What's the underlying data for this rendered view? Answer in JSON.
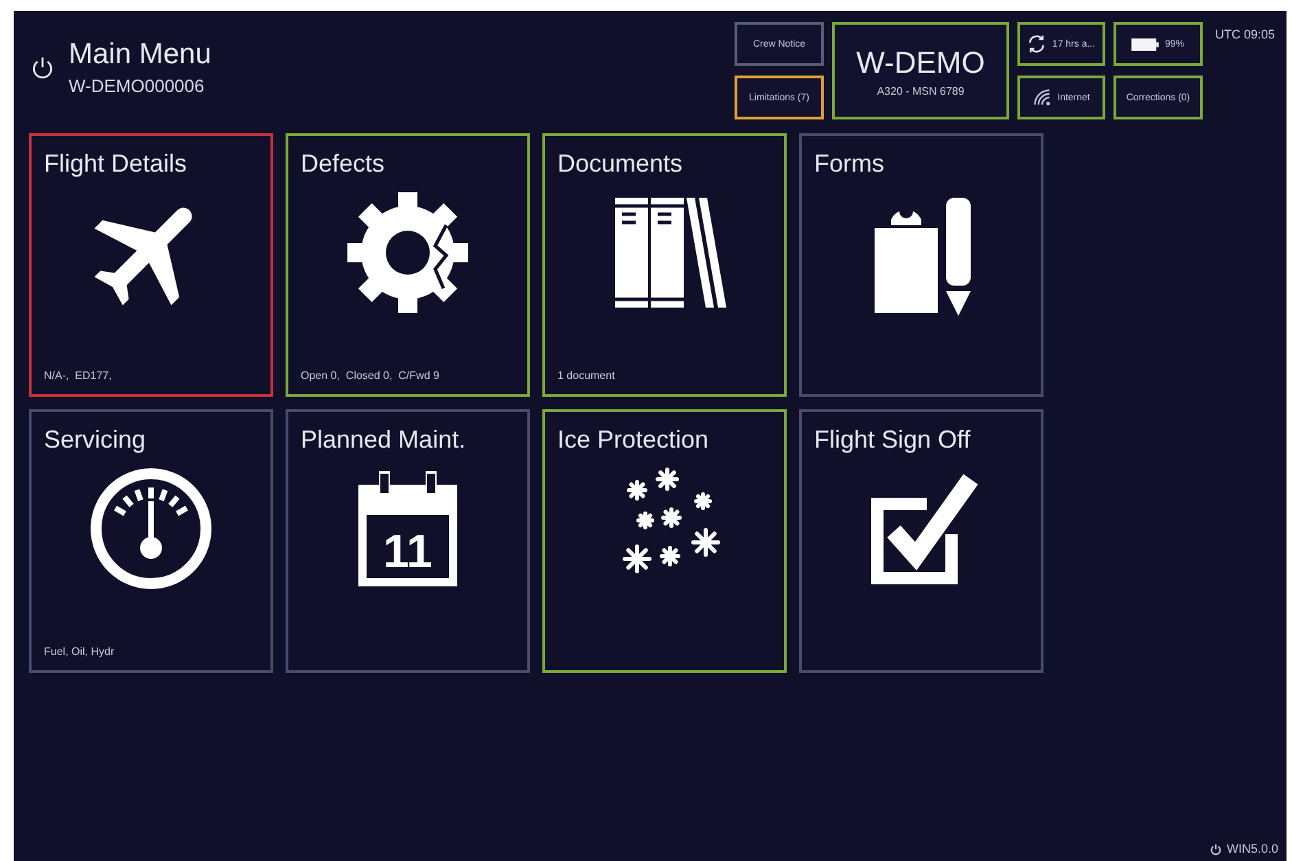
{
  "header": {
    "title": "Main Menu",
    "subtitle": "W-DEMO000006"
  },
  "status": {
    "crew_notice": {
      "label": "Crew Notice",
      "color": "#5a5a7a"
    },
    "limitations": {
      "label": "Limitations (7)",
      "color": "#e0a030"
    },
    "aircraft": {
      "registration": "W-DEMO",
      "type": "A320 - MSN 6789",
      "color": "#7aa83a"
    },
    "sync": {
      "label": "17 hrs a...",
      "color": "#7aa83a"
    },
    "battery": {
      "label": "99%",
      "color": "#7aa83a"
    },
    "internet": {
      "label": "Internet",
      "color": "#7aa83a"
    },
    "corrections": {
      "label": "Corrections (0)",
      "color": "#7aa83a"
    },
    "clock": "UTC 09:05"
  },
  "tiles": [
    {
      "title": "Flight Details",
      "info": "N/A-,  ED177,",
      "color": "#c8303a"
    },
    {
      "title": "Defects",
      "info": "Open 0,  Closed 0,  C/Fwd 9",
      "color": "#7aa83a"
    },
    {
      "title": "Documents",
      "info": "1 document",
      "color": "#7aa83a"
    },
    {
      "title": "Forms",
      "color": "#4a4a6e"
    },
    {
      "title": "Servicing",
      "info": "Fuel, Oil, Hydr",
      "color": "#4a4a6e"
    },
    {
      "title": "Planned Maint.",
      "icon_text": "11",
      "color": "#4a4a6e"
    },
    {
      "title": "Ice Protection",
      "color": "#7aa83a"
    },
    {
      "title": "Flight Sign Off",
      "color": "#4a4a6e"
    }
  ],
  "version": "WIN5.0.0"
}
